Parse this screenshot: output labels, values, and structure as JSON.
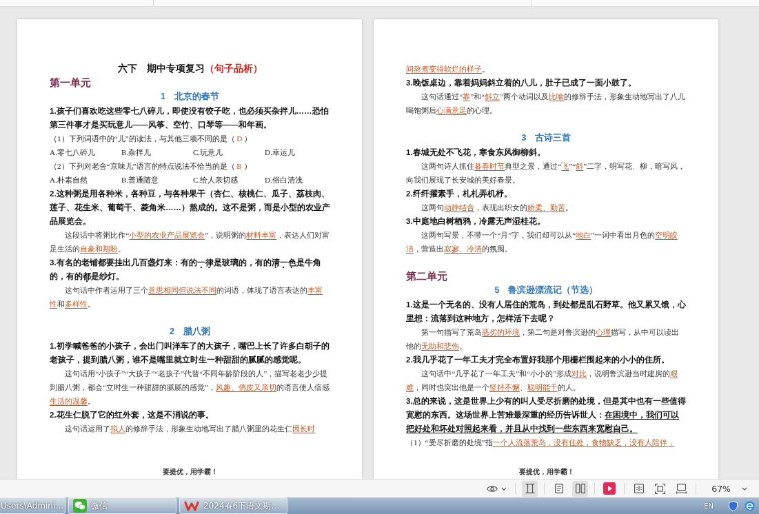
{
  "pages": [
    {
      "blocks": [
        {
          "kind": "title",
          "segments": [
            {
              "kind": "plain",
              "text": "六下　期中专项复习"
            },
            {
              "kind": "accent",
              "text": "（句子品析）"
            }
          ]
        },
        {
          "kind": "unit",
          "text": "第一单元"
        },
        {
          "kind": "lesson",
          "text": "1　北京的春节"
        },
        {
          "kind": "question",
          "text": "1.孩子们喜欢吃这些零七八碎儿，即使没有饺子吃，也必须买杂拌儿……恐怕第三件事才是买玩意儿——风筝、空竹、口琴等——和年画。"
        },
        {
          "kind": "sub_question",
          "segments": [
            {
              "kind": "plain",
              "text": "（1）下列词语中的“儿”的读法，与其他三项不同的是（ "
            },
            {
              "kind": "choice",
              "text": "D"
            },
            {
              "kind": "plain",
              "text": " ）"
            }
          ]
        },
        {
          "kind": "options",
          "options": [
            "A.零七八碎儿",
            "B.杂拌儿",
            "C.玩意儿",
            "D.幸运儿"
          ]
        },
        {
          "kind": "sub_question",
          "segments": [
            {
              "kind": "plain",
              "text": "（2）下列对老舍“京味儿”语言的特点说法不恰当的是（ "
            },
            {
              "kind": "choice",
              "text": "B"
            },
            {
              "kind": "plain",
              "text": " ）"
            }
          ]
        },
        {
          "kind": "options",
          "options": [
            "A.朴素自然",
            "B.普通随意",
            "C.给人亲切感",
            "D.俗白清浅"
          ]
        },
        {
          "kind": "question",
          "text": "2.这种粥是用各种米，各种豆，与各种果干（杏仁、核桃仁、瓜子、荔枝肉、莲子、花生米、葡萄干、菱角米……）熬成的。这不是粥，而是小型的农业产品展览会。"
        },
        {
          "kind": "answer",
          "segments": [
            {
              "kind": "plain",
              "text": "这段话中将粥比作“"
            },
            {
              "kind": "answer",
              "text": "小型的农业产品展览会"
            },
            {
              "kind": "plain",
              "text": "”，说明粥的"
            },
            {
              "kind": "answer",
              "text": "材料丰富"
            },
            {
              "kind": "plain",
              "text": "，表达人们对富足生活的"
            },
            {
              "kind": "answer",
              "text": "自豪和期盼"
            },
            {
              "kind": "plain",
              "text": "。"
            }
          ]
        },
        {
          "kind": "question",
          "segments": [
            {
              "kind": "plain",
              "text": "3.有名的老铺都要挂出几百盏灯来：有的"
            },
            {
              "kind": "dotted",
              "text": "一律"
            },
            {
              "kind": "plain",
              "text": "是玻璃的，有的"
            },
            {
              "kind": "dotted",
              "text": "清一色"
            },
            {
              "kind": "plain",
              "text": "是牛角的，有的"
            },
            {
              "kind": "dotted",
              "text": "都"
            },
            {
              "kind": "plain",
              "text": "是纱灯。"
            }
          ]
        },
        {
          "kind": "answer",
          "segments": [
            {
              "kind": "plain",
              "text": "这句话中作者运用了三个"
            },
            {
              "kind": "answer",
              "text": "意思相同但说法不同"
            },
            {
              "kind": "plain",
              "text": "的词语，体现了语言表达的"
            },
            {
              "kind": "answer",
              "text": "丰富性"
            },
            {
              "kind": "plain",
              "text": "和"
            },
            {
              "kind": "answer",
              "text": "多样性"
            },
            {
              "kind": "plain",
              "text": "。"
            }
          ]
        },
        {
          "kind": "lesson",
          "text": "2　腊八粥"
        },
        {
          "kind": "question",
          "text": "1.初学喊爸爸的小孩子，会出门叫洋车了的大孩子，嘴巴上长了许多白胡子的老孩子，提到腊八粥，谁不是嘴里就立时生一种甜甜的腻腻的感觉呢。"
        },
        {
          "kind": "answer",
          "segments": [
            {
              "kind": "plain",
              "text": "这句话用“小孩子”“大孩子”“老孩子”代替“不同年龄阶段的人”，描写老老少少提到腊八粥，都会“立时生一种甜甜的腻腻的感觉”，"
            },
            {
              "kind": "answer",
              "text": "风趣、俏皮又亲切"
            },
            {
              "kind": "plain",
              "text": "的语言使人倍感"
            },
            {
              "kind": "answer",
              "text": "生活的温馨"
            },
            {
              "kind": "plain",
              "text": "。"
            }
          ]
        },
        {
          "kind": "question",
          "text": "2.花生仁脱了它的红外套，这是不消说的事。"
        },
        {
          "kind": "answer",
          "segments": [
            {
              "kind": "plain",
              "text": "这句话运用了"
            },
            {
              "kind": "answer",
              "text": "拟人"
            },
            {
              "kind": "plain",
              "text": "的修辞手法，形象生动地写出了腊八粥里的花生仁"
            },
            {
              "kind": "answer",
              "text": "因长时"
            }
          ]
        }
      ],
      "footer": "要提优，用学霸！"
    },
    {
      "blocks": [
        {
          "kind": "continuation",
          "segments": [
            {
              "kind": "answer",
              "text": "间熬煮变得软烂的样子"
            },
            {
              "kind": "plain",
              "text": "。"
            }
          ]
        },
        {
          "kind": "question",
          "text": "3.晚饭桌边，靠着妈妈斜立着的八儿，肚子已成了一面小鼓了。"
        },
        {
          "kind": "answer",
          "segments": [
            {
              "kind": "plain",
              "text": "这句话通过“"
            },
            {
              "kind": "answer",
              "text": "靠"
            },
            {
              "kind": "plain",
              "text": "”和“"
            },
            {
              "kind": "answer",
              "text": "斜立"
            },
            {
              "kind": "plain",
              "text": "”两个动词以及"
            },
            {
              "kind": "answer",
              "text": "比喻"
            },
            {
              "kind": "plain",
              "text": "的修辞手法，形象生动地写出了八儿喝饱粥后"
            },
            {
              "kind": "answer",
              "text": "心满意足"
            },
            {
              "kind": "plain",
              "text": "的心理。"
            }
          ]
        },
        {
          "kind": "lesson",
          "text": "3　古诗三首"
        },
        {
          "kind": "question",
          "text": "1.春城无处不飞花，寒食东风御柳斜。"
        },
        {
          "kind": "answer",
          "segments": [
            {
              "kind": "plain",
              "text": "这两句诗人抓住"
            },
            {
              "kind": "answer",
              "text": "暮春时节"
            },
            {
              "kind": "plain",
              "text": "典型之景，通过“"
            },
            {
              "kind": "answer",
              "text": "飞"
            },
            {
              "kind": "plain",
              "text": "”“"
            },
            {
              "kind": "answer",
              "text": "斜"
            },
            {
              "kind": "plain",
              "text": "”二字，明写花、柳，暗写风，向我们展现了长安城的美好春景。"
            }
          ]
        },
        {
          "kind": "question",
          "text": "2.纤纤擢素手，札札弄机杼。"
        },
        {
          "kind": "answer",
          "segments": [
            {
              "kind": "plain",
              "text": "这两句"
            },
            {
              "kind": "answer",
              "text": "动静结合"
            },
            {
              "kind": "plain",
              "text": "，表现出织女的"
            },
            {
              "kind": "answer",
              "text": "娇柔、勤苦"
            },
            {
              "kind": "plain",
              "text": "。"
            }
          ]
        },
        {
          "kind": "question",
          "text": "3.中庭地白树栖鸦，冷露无声湿桂花。"
        },
        {
          "kind": "answer",
          "segments": [
            {
              "kind": "plain",
              "text": "这两句写景，不带一个“月”字，我们却可以从“"
            },
            {
              "kind": "answer",
              "text": "地白"
            },
            {
              "kind": "plain",
              "text": "”一词中看出月色的"
            },
            {
              "kind": "answer",
              "text": "空明皎洁"
            },
            {
              "kind": "plain",
              "text": "，营造出"
            },
            {
              "kind": "answer",
              "text": "寂寥、冷清"
            },
            {
              "kind": "plain",
              "text": "的氛围。"
            }
          ]
        },
        {
          "kind": "unit",
          "text": "第二单元"
        },
        {
          "kind": "lesson",
          "text": "5　鲁滨逊漂流记（节选）"
        },
        {
          "kind": "question",
          "text": "1.这是一个无名的、没有人居住的荒岛，到处都是乱石野草。他又累又饿，心里想：流落到这种地方，怎样活下去呢？"
        },
        {
          "kind": "answer",
          "segments": [
            {
              "kind": "plain",
              "text": "第一句描写了荒岛"
            },
            {
              "kind": "answer",
              "text": "恶劣的环境"
            },
            {
              "kind": "plain",
              "text": "，第二句是对鲁滨逊的"
            },
            {
              "kind": "answer",
              "text": "心理"
            },
            {
              "kind": "plain",
              "text": "描写，从中可以读出他的"
            },
            {
              "kind": "answer",
              "text": "无助和悲伤"
            },
            {
              "kind": "plain",
              "text": "。"
            }
          ]
        },
        {
          "kind": "question",
          "text": "2.我几乎花了一年工夫才完全布置好我那个用栅栏围起来的小小的住所。"
        },
        {
          "kind": "answer",
          "segments": [
            {
              "kind": "plain",
              "text": "这句话中“几乎花了一年工夫”和“小小的”形成"
            },
            {
              "kind": "answer",
              "text": "对比"
            },
            {
              "kind": "plain",
              "text": "，说明鲁滨逊当时建房的"
            },
            {
              "kind": "answer",
              "text": "艰难"
            },
            {
              "kind": "plain",
              "text": "，同时也突出他是一个"
            },
            {
              "kind": "answer",
              "text": "坚持不懈"
            },
            {
              "kind": "plain",
              "text": "、"
            },
            {
              "kind": "answer",
              "text": "聪明能干"
            },
            {
              "kind": "plain",
              "text": "的人。"
            }
          ]
        },
        {
          "kind": "question",
          "segments": [
            {
              "kind": "plain",
              "text": "3.总的来说，这是世界上少有的叫人受尽折磨的处境，但是其中也有一些值得宽慰的东西。这场世界上苦难最深重的经历告诉世人："
            },
            {
              "kind": "underlined",
              "text": "在困境中，我们可以把好处和坏处对照起来看，并且从中找到一些东西来宽慰自己。"
            }
          ]
        },
        {
          "kind": "sub_question",
          "segments": [
            {
              "kind": "plain",
              "text": "（1）“受尽折磨的处境”指"
            },
            {
              "kind": "answer",
              "text": "一个人流落荒岛，没有住处，食物缺乏，没有人陪伴，"
            }
          ]
        }
      ],
      "footer": "要提优，用学霸！"
    }
  ],
  "view_toolbar": {
    "buttons": [
      {
        "selected": false
      },
      {
        "selected": true
      },
      {
        "selected": false
      },
      {
        "selected": true
      },
      {
        "selected": false
      },
      {
        "selected": false
      },
      {
        "selected": false
      },
      {
        "selected": false
      }
    ],
    "zoom": "67%"
  },
  "taskbar": {
    "windows": [
      {
        "label": "Users\\Admini…"
      },
      {
        "label": "微信"
      },
      {
        "label": "2024春6下语文期…"
      }
    ],
    "language": "EN"
  }
}
